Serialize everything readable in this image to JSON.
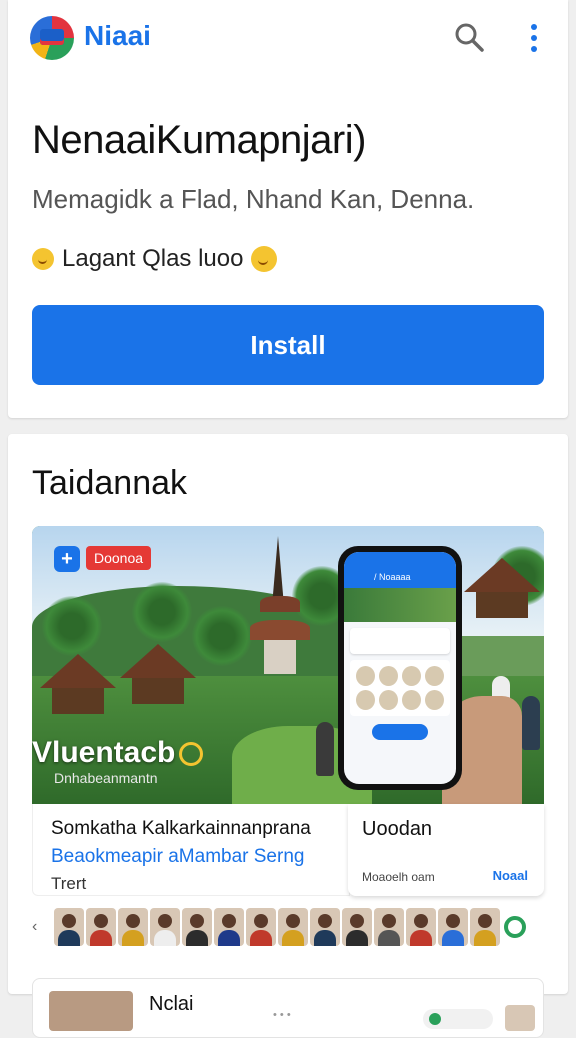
{
  "header": {
    "brand": "Niaai",
    "search_icon": "search-icon",
    "menu_icon": "more-vert-icon"
  },
  "app": {
    "title": "NenaaiKumapnjari)",
    "subtitle": "Memagidk a Flad, Nhand Kan, Denna.",
    "rating_text": "Lagant Qlas luoo",
    "install_label": "Install"
  },
  "section": {
    "title": "Taidannak",
    "feature": {
      "tag": "Doonoa",
      "headline": "Vluentacb",
      "caption": "Dnhabeanmantn"
    },
    "phone": {
      "header": "/ Noaaaa"
    },
    "info_left": {
      "line1": "Somkatha Kalkarkainnanprana",
      "line2": "Beaokmeapir aMambar Serng",
      "line3": "Trert"
    },
    "info_right": {
      "title": "Uoodan",
      "meta": "Moaoelh oam",
      "action": "Noaal"
    },
    "thumbnails": [
      {
        "color": "#1f3a5a"
      },
      {
        "color": "#c0392b"
      },
      {
        "color": "#d4a020"
      },
      {
        "color": "#eeeeee"
      },
      {
        "color": "#2c2c2c"
      },
      {
        "color": "#1f3a8a"
      },
      {
        "color": "#c0392b"
      },
      {
        "color": "#d4a020"
      },
      {
        "color": "#1f3a5a"
      },
      {
        "color": "#2c2c2c"
      },
      {
        "color": "#555555"
      },
      {
        "color": "#c0392b"
      },
      {
        "color": "#2a6ed8"
      },
      {
        "color": "#d4a020"
      }
    ]
  },
  "bottom_card": {
    "title": "Nclai"
  },
  "colors": {
    "accent": "#1a73e8",
    "tag_red": "#e53935",
    "success_green": "#2aa05a"
  }
}
